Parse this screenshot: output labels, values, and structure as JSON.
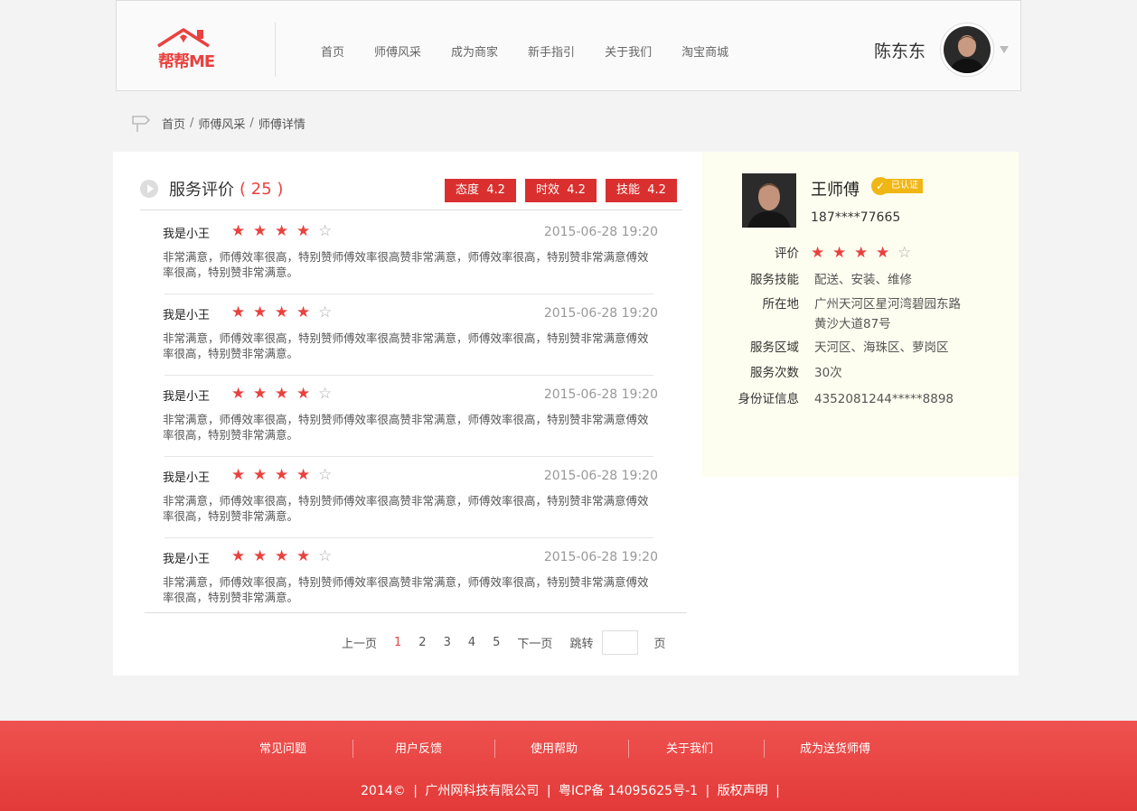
{
  "header": {
    "logo_text": "帮帮ME",
    "nav": [
      "首页",
      "师傅风采",
      "成为商家",
      "新手指引",
      "关于我们",
      "淘宝商城"
    ],
    "user_name": "陈东东"
  },
  "breadcrumb": [
    "首页",
    "师傅风采",
    "师傅详情"
  ],
  "reviews_section": {
    "title": "服务评价",
    "count": "( 25 )",
    "scores": [
      {
        "label": "态度",
        "value": "4.2"
      },
      {
        "label": "时效",
        "value": "4.2"
      },
      {
        "label": "技能",
        "value": "4.2"
      }
    ],
    "items": [
      {
        "user": "我是小王",
        "rating": 4,
        "date": "2015-06-28 19:20",
        "text": "非常满意，师傅效率很高，特别赞师傅效率很高赞非常满意，师傅效率很高，特别赞非常满意傅效率很高，特别赞非常满意。"
      },
      {
        "user": "我是小王",
        "rating": 4,
        "date": "2015-06-28 19:20",
        "text": "非常满意，师傅效率很高，特别赞师傅效率很高赞非常满意，师傅效率很高，特别赞非常满意傅效率很高，特别赞非常满意。"
      },
      {
        "user": "我是小王",
        "rating": 4,
        "date": "2015-06-28 19:20",
        "text": "非常满意，师傅效率很高，特别赞师傅效率很高赞非常满意，师傅效率很高，特别赞非常满意傅效率很高，特别赞非常满意。"
      },
      {
        "user": "我是小王",
        "rating": 4,
        "date": "2015-06-28 19:20",
        "text": "非常满意，师傅效率很高，特别赞师傅效率很高赞非常满意，师傅效率很高，特别赞非常满意傅效率很高，特别赞非常满意。"
      },
      {
        "user": "我是小王",
        "rating": 4,
        "date": "2015-06-28 19:20",
        "text": "非常满意，师傅效率很高，特别赞师傅效率很高赞非常满意，师傅效率很高，特别赞非常满意傅效率很高，特别赞非常满意。"
      }
    ]
  },
  "pagination": {
    "prev": "上一页",
    "pages": [
      "1",
      "2",
      "3",
      "4",
      "5"
    ],
    "current": "1",
    "next": "下一页",
    "jump": "跳转",
    "page_unit": "页"
  },
  "master": {
    "name": "王师傅",
    "verified": "已认证",
    "phone": "187****77665",
    "rating_label": "评价",
    "rating": 4,
    "fields": [
      {
        "key": "服务技能",
        "value": "配送、安装、维修"
      },
      {
        "key": "所在地",
        "value": "广州天河区星河湾碧园东路",
        "value2": "黄沙大道87号"
      },
      {
        "key": "服务区域",
        "value": "天河区、海珠区、萝岗区"
      },
      {
        "key": "服务次数",
        "value": "30次"
      },
      {
        "key": "身份证信息",
        "value": "4352081244*****8898"
      }
    ]
  },
  "footer": {
    "links": [
      "常见问题",
      "用户反馈",
      "使用帮助",
      "关于我们",
      "成为送货师傅"
    ],
    "copyright": [
      "2014©",
      "广州网科技有限公司",
      "粤ICP备 14095625号-1",
      "版权声明"
    ]
  },
  "colors": {
    "accent": "#e8423f",
    "score_bg": "#d9302f",
    "badge": "#f0b614",
    "side_bg": "#fefef0"
  }
}
